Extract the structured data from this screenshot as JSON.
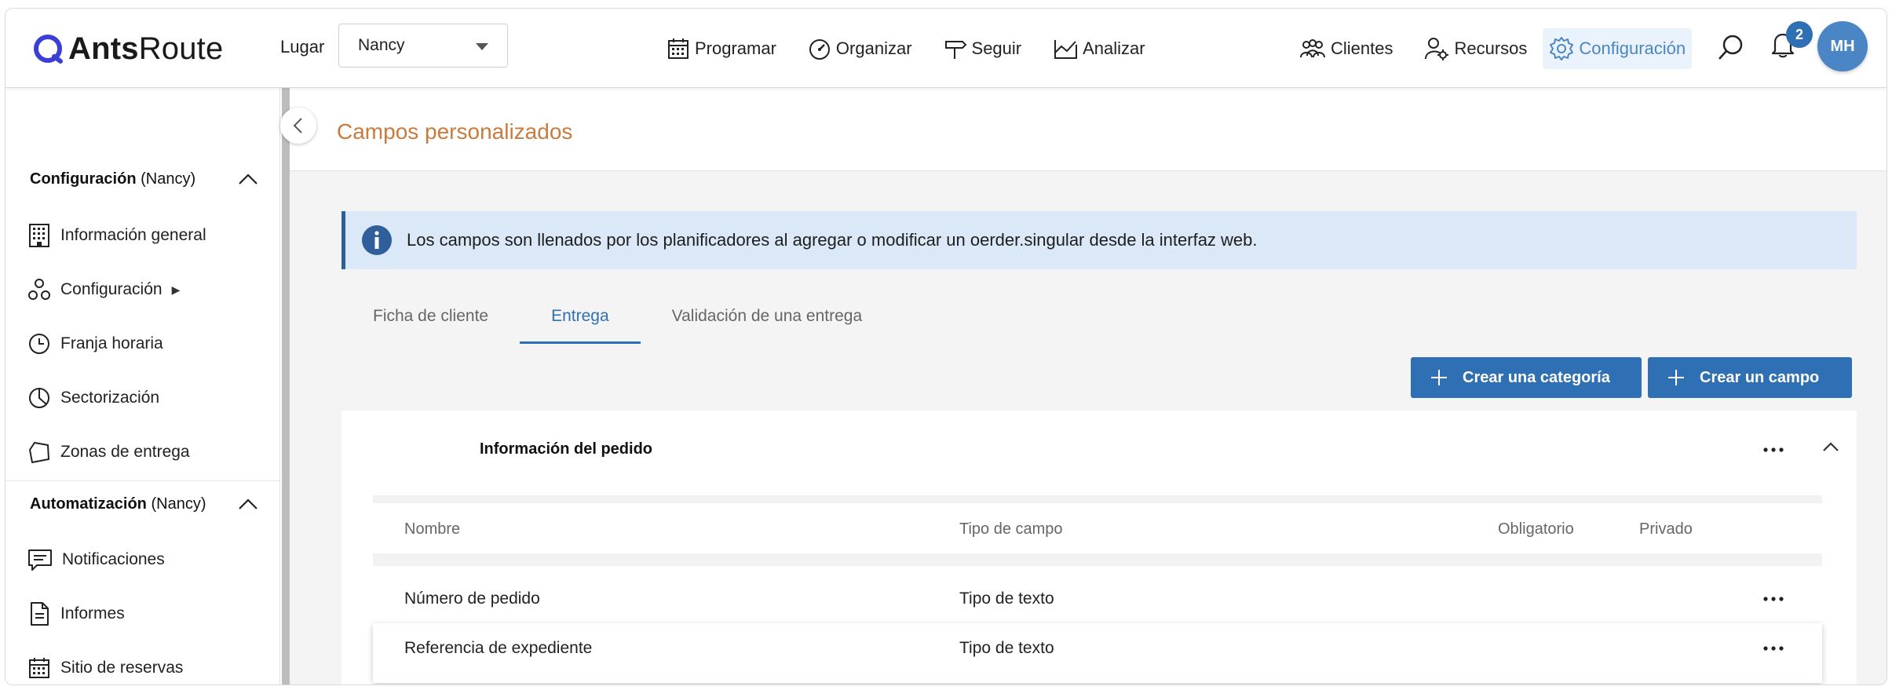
{
  "app": {
    "logo_bold": "Ants",
    "logo_light": "Route"
  },
  "header": {
    "lugar_label": "Lugar",
    "lugar_value": "Nancy",
    "nav": [
      {
        "label": "Programar",
        "icon": "calendar-icon"
      },
      {
        "label": "Organizar",
        "icon": "gauge-icon"
      },
      {
        "label": "Seguir",
        "icon": "signpost-icon"
      },
      {
        "label": "Analizar",
        "icon": "chart-icon"
      }
    ],
    "right_nav": [
      {
        "label": "Clientes",
        "icon": "users-icon"
      },
      {
        "label": "Recursos",
        "icon": "user-gear-icon"
      },
      {
        "label": "Configuración",
        "icon": "gear-icon",
        "active": true
      }
    ],
    "notifications_count": "2",
    "avatar_initials": "MH"
  },
  "sidebar": {
    "section1": {
      "title_bold": "Configuración",
      "title_light": " (Nancy)"
    },
    "section1_items": [
      {
        "label": "Información general",
        "icon": "building-icon"
      },
      {
        "label": "Configuración",
        "icon": "components-icon",
        "arrow": "▶"
      },
      {
        "label": "Franja horaria",
        "icon": "clock-icon"
      },
      {
        "label": "Sectorización",
        "icon": "pie-icon"
      },
      {
        "label": "Zonas de entrega",
        "icon": "polygon-icon"
      }
    ],
    "section2": {
      "title_bold": "Automatización",
      "title_light": " (Nancy)"
    },
    "section2_items": [
      {
        "label": "Notificaciones",
        "icon": "message-icon"
      },
      {
        "label": "Informes",
        "icon": "document-icon"
      },
      {
        "label": "Sitio de reservas",
        "icon": "calendar-grid-icon"
      }
    ]
  },
  "main": {
    "title": "Campos personalizados",
    "info_text": "Los campos son llenados por los planificadores al agregar o modificar un oerder.singular desde la interfaz web.",
    "tabs": [
      {
        "label": "Ficha de cliente",
        "active": false
      },
      {
        "label": "Entrega",
        "active": true
      },
      {
        "label": "Validación de una entrega",
        "active": false
      }
    ],
    "create_category_label": "Crear una categoría",
    "create_field_label": "Crear un campo",
    "card_title": "Información del pedido",
    "columns": {
      "name": "Nombre",
      "type": "Tipo de campo",
      "required": "Obligatorio",
      "private": "Privado"
    },
    "rows": [
      {
        "name": "Número de pedido",
        "type": "Tipo de texto"
      },
      {
        "name": "Referencia de expediente",
        "type": "Tipo de texto"
      }
    ]
  },
  "colors": {
    "accent": "#2f6fb3",
    "title": "#c87b3e",
    "banner": "#dbe8f7"
  }
}
